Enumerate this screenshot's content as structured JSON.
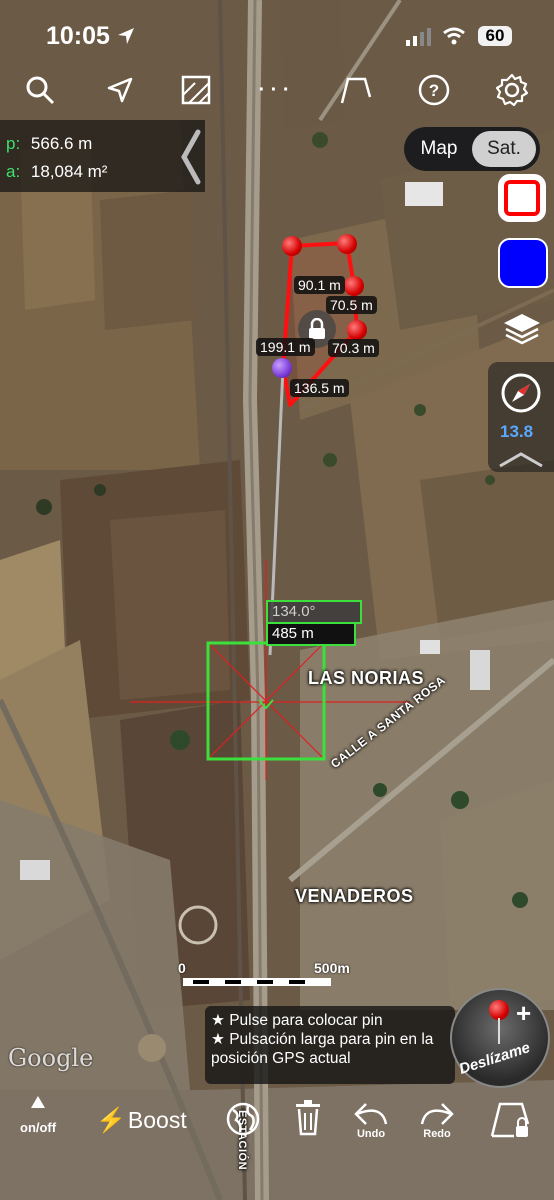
{
  "status_bar": {
    "time": "10:05",
    "battery": "60"
  },
  "toolbar": {
    "search_icon": "search-icon",
    "location_icon": "location-arrow-icon",
    "map_icon": "map-frame-icon",
    "more_icon": "more-dots-icon",
    "more_label": "· · ·",
    "elevation_icon": "profile-icon",
    "help_icon": "help-icon",
    "settings_icon": "gear-icon"
  },
  "measurements": {
    "perimeter_key": "p:",
    "perimeter": "566.6 m",
    "area_key": "a:",
    "area": "18,084 m²"
  },
  "map_type": {
    "map_label": "Map",
    "sat_label": "Sat.",
    "selected": "Sat."
  },
  "colors": {
    "line_red": "#ff0000",
    "fill_blue": "#0000ff",
    "accent_green": "#3ce03c",
    "compass_blue": "#5aa8ff"
  },
  "compass": {
    "zoom": "13.8"
  },
  "segment_labels": [
    "90.1 m",
    "70.5 m",
    "70.3 m",
    "199.1 m",
    "136.5 m"
  ],
  "ruler": {
    "angle": "134.0°",
    "distance": "485 m"
  },
  "place_names": {
    "las_norias": "LAS NORIAS",
    "venaderos": "VENADEROS",
    "calle": "CALLE A SANTA ROSA",
    "estacion": "ESTACIÓN"
  },
  "scale": {
    "start": "0",
    "end": "500m"
  },
  "google": "Google",
  "hint": {
    "line1": "★ Pulse para colocar pin",
    "line2": "★ Pulsación larga para pin en la posición GPS actual"
  },
  "slide_button": {
    "label": "Deslízame"
  },
  "bottom_bar": {
    "onoff": "on/off",
    "boost": "Boost",
    "undo": "Undo",
    "redo": "Redo"
  }
}
